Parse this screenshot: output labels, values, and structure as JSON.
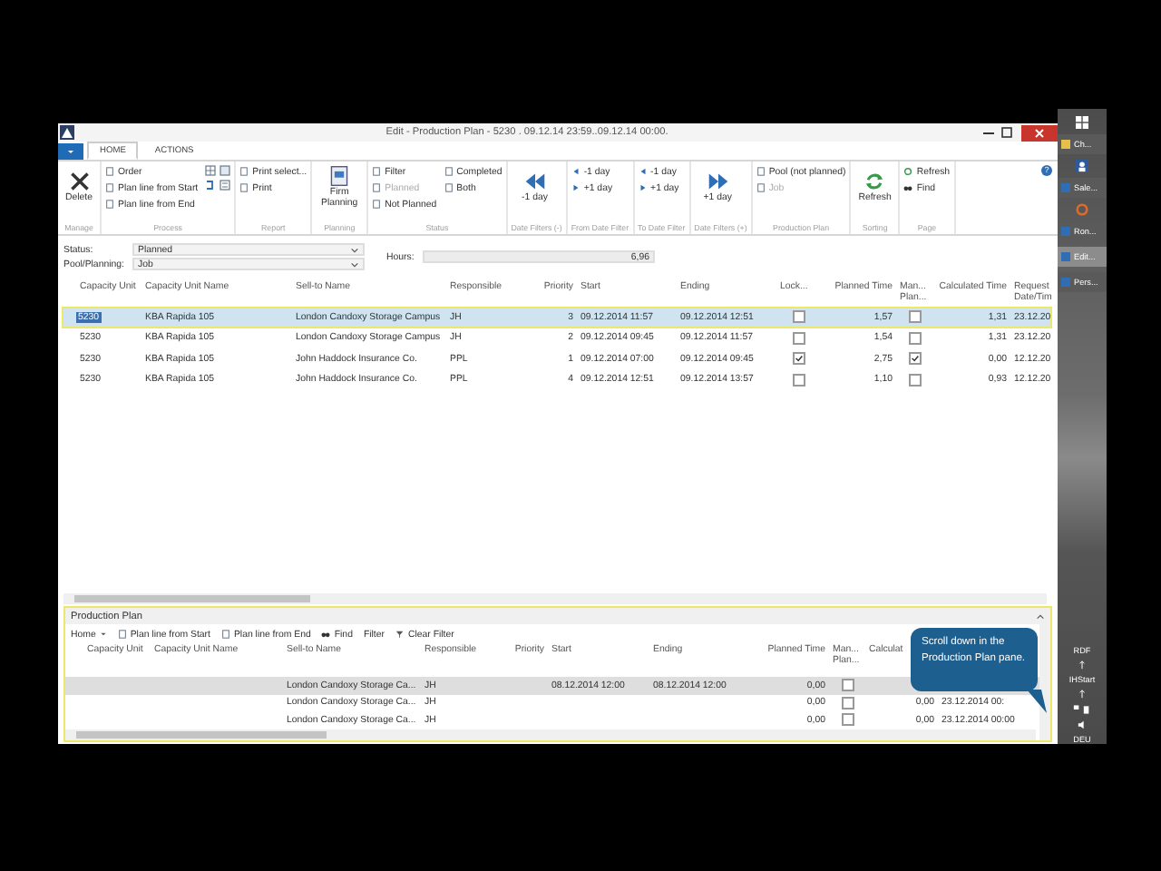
{
  "window": {
    "title": "Edit - Production Plan - 5230 . 09.12.14 23:59..09.12.14 00:00.",
    "tabs": [
      {
        "label": "HOME",
        "selected": true
      },
      {
        "label": "ACTIONS",
        "selected": false
      }
    ],
    "help": "?"
  },
  "ribbon": {
    "groups": [
      {
        "label": "Manage",
        "items": [
          {
            "kind": "large",
            "label": "Delete",
            "disabled": false
          }
        ]
      },
      {
        "label": "Process",
        "items": [
          {
            "kind": "small",
            "label": "Order",
            "disabled": false
          },
          {
            "kind": "small",
            "label": "Plan line from Start",
            "disabled": false
          },
          {
            "kind": "small",
            "label": "Plan line from End",
            "disabled": false
          }
        ]
      },
      {
        "label": "Report",
        "items": [
          {
            "kind": "small",
            "label": "Print select...",
            "disabled": false
          },
          {
            "kind": "small",
            "label": "Print",
            "disabled": false
          }
        ]
      },
      {
        "label": "Planning",
        "items": [
          {
            "kind": "large",
            "label": "Firm Planning",
            "disabled": false
          }
        ]
      },
      {
        "label": "Status",
        "items": [
          {
            "kind": "small",
            "label": "Filter",
            "disabled": false
          },
          {
            "kind": "small",
            "label": "Planned",
            "disabled": true
          },
          {
            "kind": "small",
            "label": "Not Planned",
            "disabled": false
          },
          {
            "kind": "small",
            "label": "Completed",
            "disabled": false
          },
          {
            "kind": "small",
            "label": "Both",
            "disabled": false
          }
        ]
      },
      {
        "label": "Date Filters (-)",
        "items": [
          {
            "kind": "large",
            "label": "-1 day",
            "disabled": false
          }
        ]
      },
      {
        "label": "From Date Filter",
        "items": [
          {
            "kind": "small",
            "label": "-1 day",
            "disabled": false
          },
          {
            "kind": "small",
            "label": "+1 day",
            "disabled": false
          }
        ]
      },
      {
        "label": "To Date Filter",
        "items": [
          {
            "kind": "small",
            "label": "-1 day",
            "disabled": false
          },
          {
            "kind": "small",
            "label": "+1 day",
            "disabled": false
          }
        ]
      },
      {
        "label": "Date Filters (+)",
        "items": [
          {
            "kind": "large",
            "label": "+1 day",
            "disabled": false
          }
        ]
      },
      {
        "label": "Production Plan",
        "items": [
          {
            "kind": "small",
            "label": "Pool (not planned)",
            "disabled": false
          },
          {
            "kind": "small",
            "label": "Job",
            "disabled": true
          }
        ]
      },
      {
        "label": "Sorting",
        "items": [
          {
            "kind": "large",
            "label": "Refresh",
            "disabled": false
          }
        ]
      },
      {
        "label": "Page",
        "items": [
          {
            "kind": "small",
            "label": "Refresh",
            "disabled": false
          },
          {
            "kind": "small",
            "label": "Find",
            "disabled": false
          }
        ]
      }
    ]
  },
  "filters": [
    {
      "label": "Status:",
      "value": "Planned"
    },
    {
      "label": "Pool/Planning:",
      "value": "Job"
    }
  ],
  "hours": {
    "label": "Hours:",
    "value": "6,96"
  },
  "table": {
    "columns": [
      {
        "label": "Capacity Unit",
        "kind": "text"
      },
      {
        "label": "Capacity Unit Name",
        "kind": "text"
      },
      {
        "label": "Sell-to Name",
        "kind": "text"
      },
      {
        "label": "Responsible",
        "kind": "text"
      },
      {
        "label": "Priority",
        "kind": "num"
      },
      {
        "label": "Start",
        "kind": "text"
      },
      {
        "label": "Ending",
        "kind": "text"
      },
      {
        "label": "Lock...",
        "kind": "text"
      },
      {
        "label": "Planned Time",
        "kind": "num"
      },
      {
        "label": "Man... Plan...",
        "kind": "text"
      },
      {
        "label": "Calculated Time",
        "kind": "num"
      },
      {
        "label": "Request Date/Tim",
        "kind": "text"
      }
    ],
    "rows": [
      {
        "selected": true,
        "capacity_unit": "5230",
        "unit_name": "KBA Rapida 105",
        "sell_to": "London Candoxy Storage Campus",
        "responsible": "JH",
        "priority": "3",
        "start": "09.12.2014 11:57",
        "ending": "09.12.2014 12:51",
        "locked": false,
        "planned_time": "1,57",
        "manual": false,
        "calculated_time": "1,31",
        "request": "23.12.20"
      },
      {
        "selected": false,
        "capacity_unit": "5230",
        "unit_name": "KBA Rapida 105",
        "sell_to": "London Candoxy Storage Campus",
        "responsible": "JH",
        "priority": "2",
        "start": "09.12.2014 09:45",
        "ending": "09.12.2014 11:57",
        "locked": false,
        "planned_time": "1,54",
        "manual": false,
        "calculated_time": "1,31",
        "request": "23.12.20"
      },
      {
        "selected": false,
        "capacity_unit": "5230",
        "unit_name": "KBA Rapida 105",
        "sell_to": "John Haddock Insurance Co.",
        "responsible": "PPL",
        "priority": "1",
        "start": "09.12.2014 07:00",
        "ending": "09.12.2014 09:45",
        "locked": true,
        "planned_time": "2,75",
        "manual": true,
        "calculated_time": "0,00",
        "request": "12.12.20"
      },
      {
        "selected": false,
        "capacity_unit": "5230",
        "unit_name": "KBA Rapida 105",
        "sell_to": "John Haddock Insurance Co.",
        "responsible": "PPL",
        "priority": "4",
        "start": "09.12.2014 12:51",
        "ending": "09.12.2014 13:57",
        "locked": false,
        "planned_time": "1,10",
        "manual": false,
        "calculated_time": "0,93",
        "request": "12.12.20"
      }
    ]
  },
  "pane": {
    "title": "Production Plan",
    "toolbar": [
      {
        "kind": "menu",
        "label": "Home"
      },
      {
        "kind": "doc",
        "label": "Plan line from Start"
      },
      {
        "kind": "doc",
        "label": "Plan line from End"
      },
      {
        "kind": "find",
        "label": "Find"
      },
      {
        "kind": "plain",
        "label": "Filter"
      },
      {
        "kind": "clear",
        "label": "Clear Filter"
      }
    ],
    "columns": [
      {
        "label": "Capacity Unit",
        "kind": "text"
      },
      {
        "label": "Capacity Unit Name",
        "kind": "text"
      },
      {
        "label": "Sell-to Name",
        "kind": "text"
      },
      {
        "label": "Responsible",
        "kind": "text"
      },
      {
        "label": "Priority",
        "kind": "num"
      },
      {
        "label": "Start",
        "kind": "text"
      },
      {
        "label": "Ending",
        "kind": "text"
      },
      {
        "label": "Planned Time",
        "kind": "num"
      },
      {
        "label": "Man... Plan...",
        "kind": "text"
      },
      {
        "label": "Calculat",
        "kind": "text"
      }
    ],
    "rows": [
      {
        "selected": true,
        "sell_to": "London Candoxy Storage Ca...",
        "responsible": "JH",
        "start": "08.12.2014 12:00",
        "ending": "08.12.2014 12:00",
        "planned_time": "0,00",
        "manual": false
      },
      {
        "selected": false,
        "sell_to": "London Candoxy Storage Ca...",
        "responsible": "JH",
        "planned_time": "0,00",
        "manual": false,
        "calculated_time": "0,00",
        "request": "23.12.2014 00:"
      },
      {
        "selected": false,
        "sell_to": "London Candoxy Storage Ca...",
        "responsible": "JH",
        "planned_time": "0,00",
        "manual": false,
        "calculated_time": "0,00",
        "request": "23.12.2014 00:00"
      }
    ],
    "callout": "Scroll down in the Production Plan pane."
  },
  "taskbar": {
    "items": [
      {
        "label": "Ch...",
        "selected": false
      },
      {
        "label": "Sale...",
        "selected": false
      },
      {
        "label": "Ron...",
        "selected": false
      },
      {
        "label": "Edit...",
        "selected": true
      },
      {
        "label": "Pers...",
        "selected": false
      }
    ],
    "tray": [
      "RDF",
      "IHStart",
      "DEU"
    ]
  }
}
